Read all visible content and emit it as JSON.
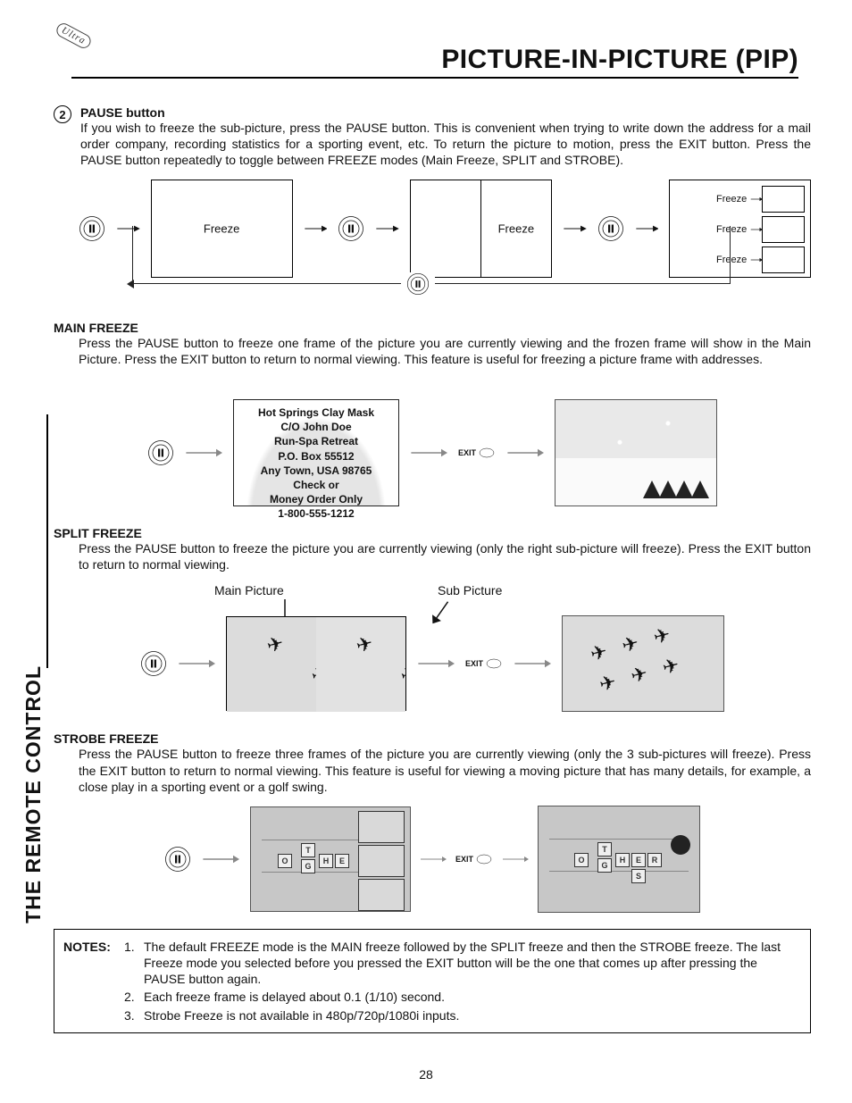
{
  "page": {
    "number": "28"
  },
  "header": {
    "title": "PICTURE-IN-PICTURE (PIP)"
  },
  "sidebar": {
    "label": "THE REMOTE CONTROL"
  },
  "sec2": {
    "num": "2",
    "title": "PAUSE button",
    "body": "If you wish to freeze the sub-picture, press the PAUSE button. This is convenient when trying to write down the address for a mail order company, recording statistics for a sporting event, etc.  To return the picture to motion, press the EXIT button.  Press the PAUSE button repeatedly to toggle between FREEZE modes (Main Freeze, SPLIT and STROBE)."
  },
  "flow1": {
    "label_a": "Freeze",
    "label_b": "Freeze",
    "label_c1": "Freeze",
    "label_c2": "Freeze",
    "label_c3": "Freeze"
  },
  "main_freeze": {
    "title": "MAIN FREEZE",
    "body": "Press the PAUSE button to freeze one frame of the picture you are currently viewing and the frozen frame will show in the Main Picture.  Press the EXIT button to return to normal viewing.  This feature is useful for freezing a picture frame with addresses."
  },
  "address_card": {
    "l1": "Hot Springs Clay Mask",
    "l2": "C/O John Doe",
    "l3": "Run-Spa Retreat",
    "l4": "P.O. Box 55512",
    "l5": "Any Town, USA 98765",
    "l6": "Check or",
    "l7": "Money Order Only",
    "l8": "1-800-555-1212"
  },
  "split_freeze": {
    "title": "SPLIT FREEZE",
    "body": "Press the PAUSE button to freeze the picture you are currently viewing (only the right sub-picture will freeze).  Press the EXIT button to return to normal viewing.",
    "label_main": "Main Picture",
    "label_sub": "Sub Picture"
  },
  "strobe_freeze": {
    "title": "STROBE FREEZE",
    "body": "Press the PAUSE button to freeze three frames of the picture you are currently viewing (only the 3 sub-pictures will freeze). Press the EXIT button to return to normal viewing. This feature is useful for viewing a moving picture that has many details, for example, a close play in a sporting event or a golf swing."
  },
  "notes": {
    "label": "NOTES:",
    "n1_num": "1.",
    "n1": "The default FREEZE mode is the MAIN freeze followed by the SPLIT freeze and then the STROBE freeze.  The last Freeze mode you selected before you pressed the EXIT button will be the one that comes up after pressing the PAUSE button again.",
    "n2_num": "2.",
    "n2": "Each freeze frame is delayed about 0.1 (1/10) second.",
    "n3_num": "3.",
    "n3": "Strobe Freeze is not available in 480p/720p/1080i inputs."
  },
  "labels": {
    "exit": "EXIT"
  }
}
